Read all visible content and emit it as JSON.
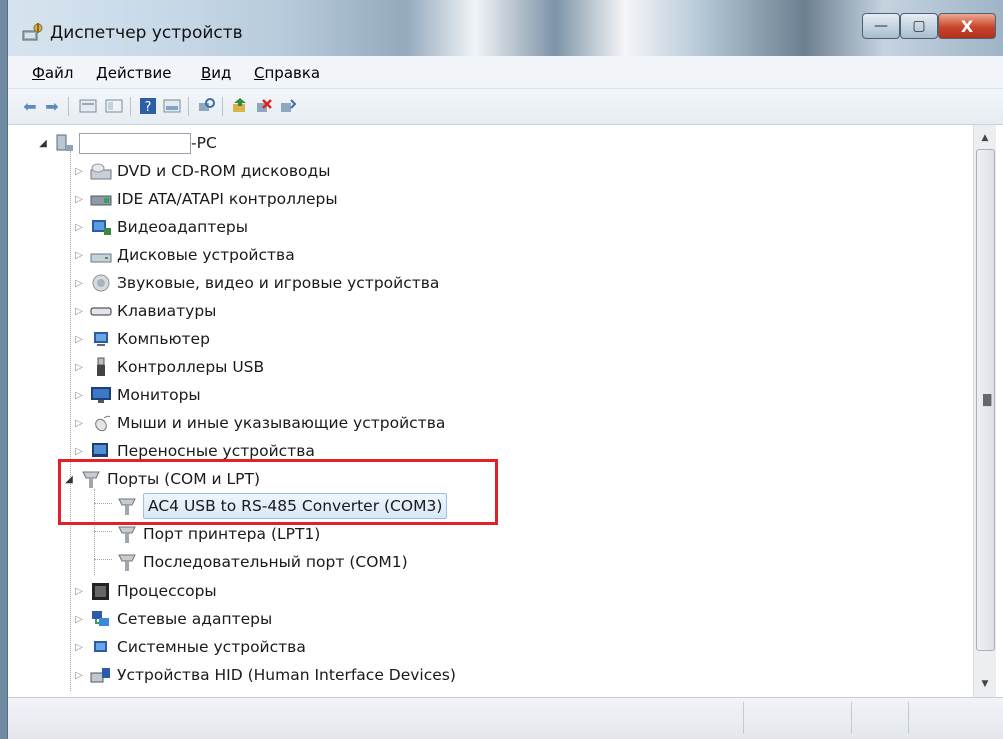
{
  "window": {
    "title": "Диспетчер устройств",
    "controls": {
      "minimize": "—",
      "maximize": "▢",
      "close": "X"
    }
  },
  "menu": [
    {
      "label": "Файл",
      "key": "Ф",
      "rest": "айл"
    },
    {
      "label": "Действие",
      "key": "Д",
      "rest": "ействие"
    },
    {
      "label": "Вид",
      "key": "В",
      "rest": "ид"
    },
    {
      "label": "Справка",
      "key": "С",
      "rest": "правка"
    }
  ],
  "toolbar": {
    "icons": [
      "back-arrow-icon",
      "forward-arrow-icon",
      "properties-icon",
      "view-icon",
      "help-icon",
      "show-hidden-icon",
      "scan-hardware-icon",
      "update-driver-icon",
      "disable-device-icon",
      "uninstall-device-icon"
    ]
  },
  "tree": {
    "root": {
      "label": "-PC",
      "name_redacted": true
    },
    "categories": [
      {
        "label": "DVD и CD-ROM дисководы",
        "icon": "dvd-drive-icon"
      },
      {
        "label": "IDE ATA/ATAPI контроллеры",
        "icon": "ide-controller-icon"
      },
      {
        "label": "Видеоадаптеры",
        "icon": "display-adapter-icon"
      },
      {
        "label": "Дисковые устройства",
        "icon": "disk-drive-icon"
      },
      {
        "label": "Звуковые, видео и игровые устройства",
        "icon": "speaker-icon"
      },
      {
        "label": "Клавиатуры",
        "icon": "keyboard-icon"
      },
      {
        "label": "Компьютер",
        "icon": "computer-icon"
      },
      {
        "label": "Контроллеры USB",
        "icon": "usb-icon"
      },
      {
        "label": "Мониторы",
        "icon": "monitor-icon"
      },
      {
        "label": "Мыши и иные указывающие устройства",
        "icon": "mouse-icon"
      },
      {
        "label": "Переносные устройства",
        "icon": "portable-device-icon"
      },
      {
        "label": "Порты (COM и LPT)",
        "icon": "port-icon",
        "expanded": true,
        "children": [
          {
            "label": "AC4 USB to RS-485 Converter (COM3)",
            "icon": "port-icon",
            "selected": true
          },
          {
            "label": "Порт принтера (LPT1)",
            "icon": "port-icon"
          },
          {
            "label": "Последовательный порт (COM1)",
            "icon": "port-icon"
          }
        ]
      },
      {
        "label": "Процессоры",
        "icon": "processor-icon"
      },
      {
        "label": "Сетевые адаптеры",
        "icon": "network-adapter-icon"
      },
      {
        "label": "Системные устройства",
        "icon": "system-device-icon"
      },
      {
        "label": "Устройства HID (Human Interface Devices)",
        "icon": "hid-icon"
      }
    ]
  },
  "colors": {
    "highlight_box": "#e2202a",
    "selection": "#d8e8f8",
    "close_button": "#c8452b"
  }
}
